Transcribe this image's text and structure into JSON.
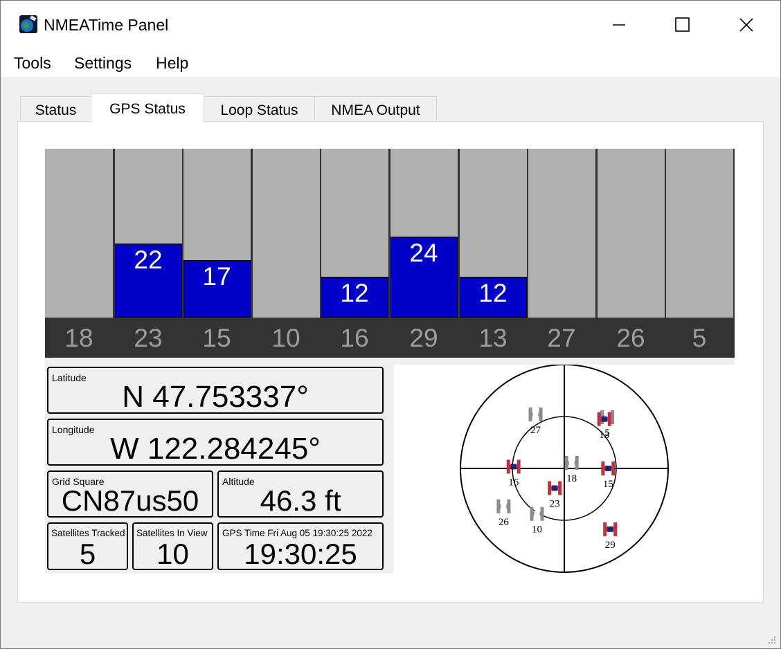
{
  "window": {
    "title": "NMEATime Panel"
  },
  "menu": [
    "Tools",
    "Settings",
    "Help"
  ],
  "tabs": [
    "Status",
    "GPS Status",
    "Loop Status",
    "NMEA Output"
  ],
  "active_tab": "GPS Status",
  "signal_bars": {
    "snr_max": 50,
    "satellites": [
      {
        "prn": "18",
        "snr": null
      },
      {
        "prn": "23",
        "snr": 22
      },
      {
        "prn": "15",
        "snr": 17
      },
      {
        "prn": "10",
        "snr": null
      },
      {
        "prn": "16",
        "snr": 12
      },
      {
        "prn": "29",
        "snr": 24
      },
      {
        "prn": "13",
        "snr": 12
      },
      {
        "prn": "27",
        "snr": null
      },
      {
        "prn": "26",
        "snr": null
      },
      {
        "prn": "5",
        "snr": null
      }
    ]
  },
  "position": {
    "latitude_label": "Latitude",
    "latitude": "N 47.753337°",
    "longitude_label": "Longitude",
    "longitude": "W 122.284245°",
    "grid_label": "Grid Square",
    "grid": "CN87us50",
    "altitude_label": "Altitude",
    "altitude": "46.3 ft",
    "tracked_label": "Satellites Tracked",
    "tracked": "5",
    "inview_label": "Satellites In View",
    "inview": "10",
    "gpstime_label": "GPS Time Fri Aug 05 19:30:25 2022",
    "gpstime": "19:30:25"
  },
  "sky": {
    "satellites": [
      {
        "prn": "27",
        "az": 332,
        "el": 37,
        "used": false
      },
      {
        "prn": "5",
        "az": 40,
        "el": 32,
        "used": false
      },
      {
        "prn": "13",
        "az": 39,
        "el": 35,
        "used": true
      },
      {
        "prn": "16",
        "az": 272,
        "el": 46,
        "used": true
      },
      {
        "prn": "18",
        "az": 53,
        "el": 82,
        "used": false
      },
      {
        "prn": "15",
        "az": 90,
        "el": 52,
        "used": true
      },
      {
        "prn": "23",
        "az": 206,
        "el": 71,
        "used": true
      },
      {
        "prn": "26",
        "az": 238,
        "el": 28,
        "used": false
      },
      {
        "prn": "10",
        "az": 211,
        "el": 44,
        "used": false
      },
      {
        "prn": "29",
        "az": 143,
        "el": 24,
        "used": true
      }
    ]
  },
  "colors": {
    "used_body": "#c0303f",
    "used_center": "#1a237e",
    "unused": "#8c8c8c",
    "bar_fill": "#0000c8",
    "bar_bg": "#b0b0b0"
  }
}
